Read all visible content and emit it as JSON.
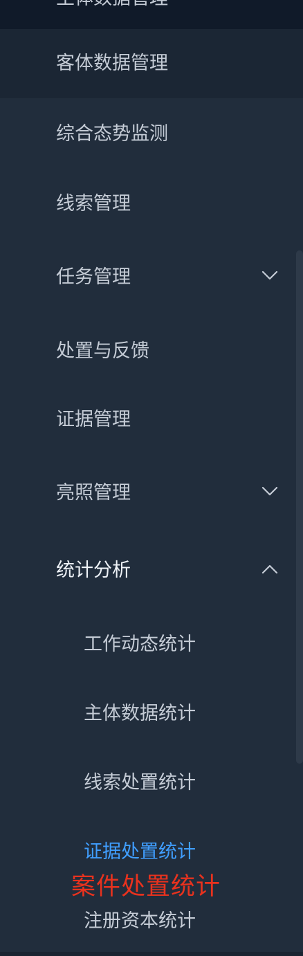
{
  "sidebar": {
    "top_partial_label": "主体数据管理",
    "items": [
      {
        "label": "客体数据管理"
      },
      {
        "label": "综合态势监测"
      },
      {
        "label": "线索管理"
      },
      {
        "label": "任务管理"
      },
      {
        "label": "处置与反馈"
      },
      {
        "label": "证据管理"
      },
      {
        "label": "亮照管理"
      },
      {
        "label": "统计分析"
      }
    ],
    "sub_items": [
      {
        "label": "工作动态统计"
      },
      {
        "label": "主体数据统计"
      },
      {
        "label": "线索处置统计"
      },
      {
        "label": "证据处置统计"
      },
      {
        "label": "注册资本统计"
      }
    ]
  },
  "annotation": {
    "text": "案件处置统计"
  },
  "colors": {
    "background": "#212d3c",
    "top_item_bg": "#101a29",
    "hover_bg": "#1b2634",
    "text": "#c5ccd6",
    "selected": "#409eff",
    "annotation": "#e8321e"
  }
}
